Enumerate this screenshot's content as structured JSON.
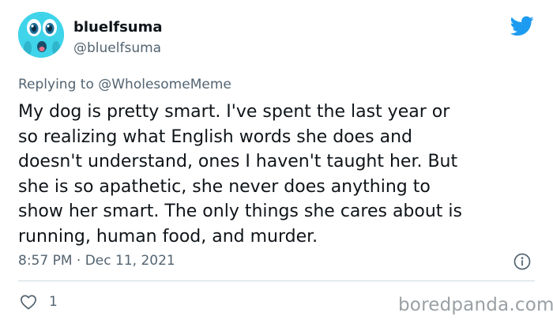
{
  "author": {
    "display_name": "bluelfsuma",
    "handle": "@bluelfsuma",
    "avatar_icon": "shocked-cartoon-face-avatar",
    "avatar_color": "#3fd4ea"
  },
  "brand": {
    "icon": "twitter-bird-icon",
    "color": "#1d9bf0"
  },
  "reply": {
    "prefix": "Replying to",
    "mention": "@WholesomeMeme"
  },
  "tweet": {
    "lines": [
      "My dog is pretty smart. I've spent the last year or",
      "so realizing what English words she does and",
      "doesn't understand, ones I haven't taught her. But",
      "she is so apathetic, she never does anything to",
      "show her smart. The only things she cares about is",
      "running, human food, and murder."
    ],
    "timestamp": "8:57 PM · Dec 11, 2021"
  },
  "actions": {
    "like_icon": "heart-icon",
    "like_count": "1",
    "info_icon": "info-icon"
  },
  "watermark": "boredpanda.com"
}
